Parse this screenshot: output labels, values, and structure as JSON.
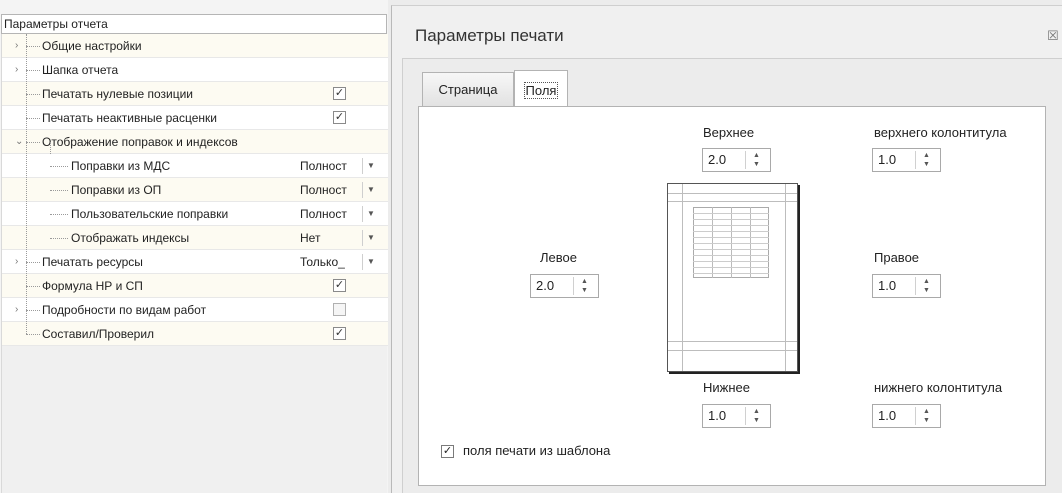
{
  "left_panel": {
    "header": "Параметры отчета",
    "rows": [
      {
        "label": "Общие настройки",
        "expander": "›"
      },
      {
        "label": "Шапка отчета",
        "expander": "›"
      },
      {
        "label": "Печатать нулевые позиции",
        "check": "✓"
      },
      {
        "label": "Печатать неактивные расценки",
        "check": "✓"
      },
      {
        "label": "Отображение поправок и индексов",
        "expander": "⌄"
      },
      {
        "label": "Поправки из МДС",
        "value": "Полност"
      },
      {
        "label": "Поправки из ОП",
        "value": "Полност"
      },
      {
        "label": "Пользовательские поправки",
        "value": "Полност"
      },
      {
        "label": "Отображать индексы",
        "value": "Нет"
      },
      {
        "label": "Печатать ресурсы",
        "value": "Только_",
        "expander": "›"
      },
      {
        "label": "Формула НР и СП",
        "check": "✓"
      },
      {
        "label": "Подробности по видам работ",
        "check": "",
        "expander": "›"
      },
      {
        "label": "Составил/Проверил",
        "check": "✓"
      }
    ],
    "combo_arrow": "▼"
  },
  "dialog": {
    "title": "Параметры печати",
    "close_glyph": "☒",
    "tabs": [
      {
        "label": "Страница"
      },
      {
        "label": "Поля"
      }
    ],
    "fields": {
      "top": {
        "label": "Верхнее",
        "value": "2.0"
      },
      "header": {
        "label": "верхнего колонтитула",
        "value": "1.0"
      },
      "left": {
        "label": "Левое",
        "value": "2.0"
      },
      "right": {
        "label": "Правое",
        "value": "1.0"
      },
      "bottom": {
        "label": "Нижнее",
        "value": "1.0"
      },
      "footer": {
        "label": "нижнего колонтитула",
        "value": "1.0"
      }
    },
    "spin_glyphs": {
      "up": "▲",
      "down": "▼"
    },
    "template_check": {
      "label": "поля печати из шаблона",
      "check": "✓"
    }
  }
}
